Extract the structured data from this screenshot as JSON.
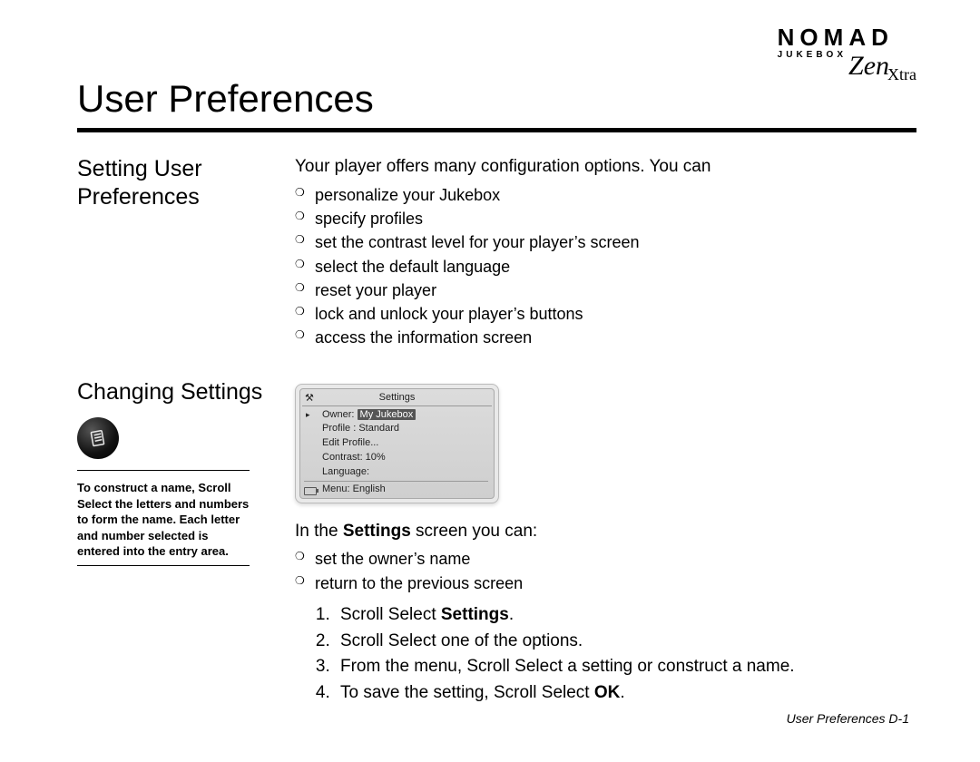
{
  "brand": {
    "line1": "NOMAD",
    "line2": "JUKEBOX",
    "script1": "Zen",
    "script2": "Xtra"
  },
  "title": "User Preferences",
  "section1": {
    "heading": "Setting User Preferences",
    "intro": "Your player offers many configuration options. You can",
    "bullets": [
      "personalize your Jukebox",
      "specify profiles",
      "set the contrast level for your player’s screen",
      "select the default language",
      "reset your player",
      "lock and unlock your player’s buttons",
      "access the information screen"
    ]
  },
  "section2": {
    "heading": "Changing Settings",
    "tip": "To construct a name, Scroll Select the letters and numbers to form the name. Each letter and number selected is entered into the entry area.",
    "device": {
      "header": "Settings",
      "owner_label": "Owner:",
      "owner_value": "My Jukebox",
      "profile": "Profile : Standard",
      "edit": "Edit Profile...",
      "contrast": "Contrast:  10%",
      "language": "Language:",
      "menu": "Menu: English"
    },
    "intro_pre": "In the ",
    "intro_bold": "Settings",
    "intro_post": " screen you can:",
    "bullets": [
      "set the owner’s name",
      "return to the previous screen"
    ],
    "steps": {
      "s1_pre": "Scroll Select ",
      "s1_bold": "Settings",
      "s1_post": ".",
      "s2": "Scroll Select one of the options.",
      "s3": "From the menu, Scroll Select a setting or construct a name.",
      "s4_pre": "To save the setting, Scroll Select ",
      "s4_bold": "OK",
      "s4_post": "."
    }
  },
  "footer": "User Preferences D-1"
}
